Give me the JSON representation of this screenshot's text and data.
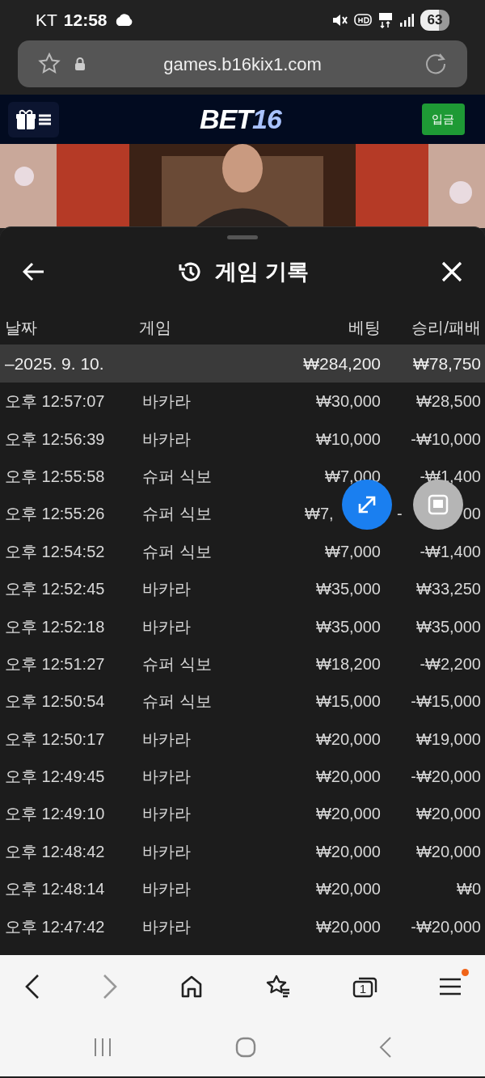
{
  "status_bar": {
    "carrier": "KT",
    "time": "12:58",
    "battery": "63"
  },
  "browser": {
    "url": "games.b16kix1.com"
  },
  "site_header": {
    "logo_main": "BET",
    "logo_accent": "16",
    "deposit_button": "입금"
  },
  "sheet": {
    "title": "게임 기록",
    "columns": [
      "날짜",
      "게임",
      "베팅",
      "승리/패배"
    ],
    "summary": {
      "date": "–2025. 9. 10.",
      "bet": "₩284,200",
      "result": "₩78,750"
    },
    "rows": [
      {
        "kind": "full",
        "time": "오후 12:57:07",
        "game": "바카라",
        "bet": "₩30,000",
        "result": "₩28,500"
      },
      {
        "kind": "full",
        "time": "오후 12:56:39",
        "game": "바카라",
        "bet": "₩10,000",
        "result": "-₩10,000"
      },
      {
        "kind": "full",
        "time": "오후 12:55:58",
        "game": "슈퍼 식보",
        "bet": "₩7,000",
        "result": "-₩1,400"
      },
      {
        "kind": "covered",
        "time": "오후 12:55:26",
        "game": "슈퍼 식보",
        "bet": "₩7,",
        "result": "-",
        "result_tail": "00"
      },
      {
        "kind": "full",
        "time": "오후 12:54:52",
        "game": "슈퍼 식보",
        "bet": "₩7,000",
        "result": "-₩1,400"
      },
      {
        "kind": "full",
        "time": "오후 12:52:45",
        "game": "바카라",
        "bet": "₩35,000",
        "result": "₩33,250"
      },
      {
        "kind": "full",
        "time": "오후 12:52:18",
        "game": "바카라",
        "bet": "₩35,000",
        "result": "₩35,000"
      },
      {
        "kind": "full",
        "time": "오후 12:51:27",
        "game": "슈퍼 식보",
        "bet": "₩18,200",
        "result": "-₩2,200"
      },
      {
        "kind": "full",
        "time": "오후 12:50:54",
        "game": "슈퍼 식보",
        "bet": "₩15,000",
        "result": "-₩15,000"
      },
      {
        "kind": "full",
        "time": "오후 12:50:17",
        "game": "바카라",
        "bet": "₩20,000",
        "result": "₩19,000"
      },
      {
        "kind": "full",
        "time": "오후 12:49:45",
        "game": "바카라",
        "bet": "₩20,000",
        "result": "-₩20,000"
      },
      {
        "kind": "full",
        "time": "오후 12:49:10",
        "game": "바카라",
        "bet": "₩20,000",
        "result": "₩20,000"
      },
      {
        "kind": "full",
        "time": "오후 12:48:42",
        "game": "바카라",
        "bet": "₩20,000",
        "result": "₩20,000"
      },
      {
        "kind": "full",
        "time": "오후 12:48:14",
        "game": "바카라",
        "bet": "₩20,000",
        "result": "₩0"
      },
      {
        "kind": "full",
        "time": "오후 12:47:42",
        "game": "바카라",
        "bet": "₩20,000",
        "result": "-₩20,000"
      }
    ]
  },
  "bottom_nav": {
    "tab_count": "1",
    "menu_badge": true
  }
}
